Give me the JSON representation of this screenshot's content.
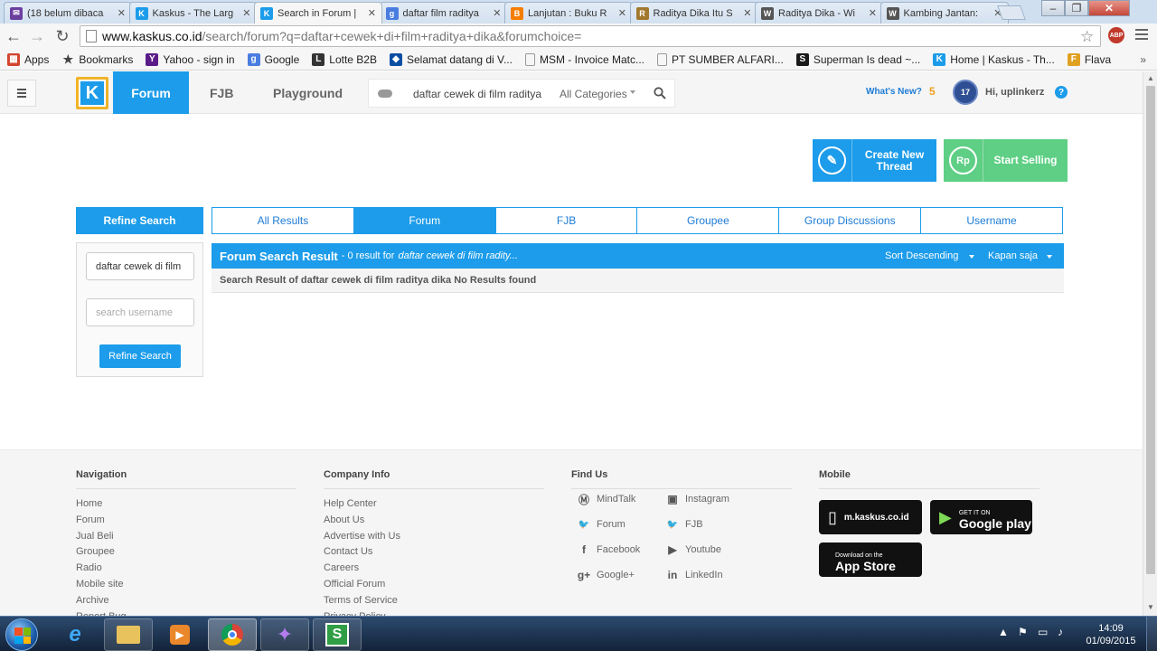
{
  "browser": {
    "tabs": [
      {
        "title": "(18 belum dibaca",
        "icon": "mail-icon",
        "color": "#6b3fa0"
      },
      {
        "title": "Kaskus - The Larg",
        "icon": "kaskus-icon",
        "color": "#1c9cea"
      },
      {
        "title": "Search in Forum |",
        "icon": "kaskus-icon",
        "color": "#1c9cea",
        "active": true
      },
      {
        "title": "daftar film raditya",
        "icon": "google-icon",
        "color": "#4a7de0"
      },
      {
        "title": "Lanjutan : Buku R",
        "icon": "blogger-icon",
        "color": "#f57d00"
      },
      {
        "title": "Raditya Dika Itu S",
        "icon": "site-icon",
        "color": "#a2782c"
      },
      {
        "title": "Raditya Dika - Wi",
        "icon": "wikipedia-icon",
        "color": "#555555"
      },
      {
        "title": "Kambing Jantan: ",
        "icon": "wikipedia-icon",
        "color": "#555555"
      }
    ],
    "url_host": "www.kaskus.co.id",
    "url_path": "/search/forum?q=daftar+cewek+di+film+raditya+dika&forumchoice=",
    "abp_label": "ABP",
    "bookmarks": [
      {
        "label": "Apps",
        "icon": "apps-icon",
        "color": "#d2452f"
      },
      {
        "label": "Bookmarks",
        "icon": "star-icon",
        "color": "#444444"
      },
      {
        "label": "Yahoo - sign in",
        "icon": "yahoo-icon",
        "color": "#5b1c8a"
      },
      {
        "label": "Google",
        "icon": "google-icon",
        "color": "#4a7de0"
      },
      {
        "label": "Lotte B2B",
        "icon": "lotte-icon",
        "color": "#333333"
      },
      {
        "label": "Selamat datang di V...",
        "icon": "site-icon",
        "color": "#0b4ea2"
      },
      {
        "label": "MSM - Invoice Matc...",
        "icon": "page-icon",
        "color": "#888888"
      },
      {
        "label": "PT SUMBER ALFARI...",
        "icon": "page-icon",
        "color": "#888888"
      },
      {
        "label": "Superman Is dead ~...",
        "icon": "sid-icon",
        "color": "#1a1a1a"
      },
      {
        "label": "Home | Kaskus - Th...",
        "icon": "kaskus-icon",
        "color": "#1c9cea"
      },
      {
        "label": "Flava",
        "icon": "flava-icon",
        "color": "#e0a020"
      }
    ]
  },
  "header": {
    "nav": {
      "forum": "Forum",
      "fjb": "FJB",
      "playground": "Playground"
    },
    "search_query": "daftar cewek di film raditya",
    "category": "All Categories",
    "whats_new": "What's New?",
    "whats_new_count": "5",
    "avatar_text": "17",
    "greeting": "Hi, uplinkerz",
    "help": "?"
  },
  "actions": {
    "create_thread": "Create New Thread",
    "create_thread_line1": "Create New",
    "create_thread_line2": "Thread",
    "start_selling": "Start Selling",
    "rp": "Rp"
  },
  "refine": {
    "title": "Refine Search",
    "keyword_value": "daftar cewek di film",
    "username_placeholder": "search username",
    "button": "Refine Search"
  },
  "result_tabs": [
    "All Results",
    "Forum",
    "FJB",
    "Groupee",
    "Group Discussions",
    "Username"
  ],
  "active_result_tab": 1,
  "results": {
    "title": "Forum Search Result",
    "count_text": "- 0 result for",
    "query_text": "daftar cewek di film radity...",
    "sort": "Sort Descending",
    "time": "Kapan saja",
    "message": "Search Result of daftar cewek di film raditya dika No Results found"
  },
  "footer": {
    "navigation": {
      "title": "Navigation",
      "links": [
        "Home",
        "Forum",
        "Jual Beli",
        "Groupee",
        "Radio",
        "Mobile site",
        "Archive",
        "Report Bug"
      ]
    },
    "company": {
      "title": "Company Info",
      "links": [
        "Help Center",
        "About Us",
        "Advertise with Us",
        "Contact Us",
        "Careers",
        "Official Forum",
        "Terms of Service",
        "Privacy Policy"
      ]
    },
    "find_us": {
      "title": "Find Us",
      "left": [
        {
          "label": "MindTalk",
          "icon": "mindtalk-icon"
        },
        {
          "label": "Forum",
          "icon": "twitter-icon"
        },
        {
          "label": "Facebook",
          "icon": "facebook-icon"
        },
        {
          "label": "Google+",
          "icon": "googleplus-icon"
        }
      ],
      "right": [
        {
          "label": "Instagram",
          "icon": "instagram-icon"
        },
        {
          "label": "FJB",
          "icon": "twitter-icon"
        },
        {
          "label": "Youtube",
          "icon": "youtube-icon"
        },
        {
          "label": "LinkedIn",
          "icon": "linkedin-icon"
        }
      ]
    },
    "mobile": {
      "title": "Mobile",
      "mkaskus": "m.kaskus.co.id",
      "gplay_small": "GET IT ON",
      "gplay_big": "Google play",
      "appstore_small": "Download on the",
      "appstore_big": "App Store"
    }
  },
  "taskbar": {
    "time": "14:09",
    "date": "01/09/2015"
  }
}
